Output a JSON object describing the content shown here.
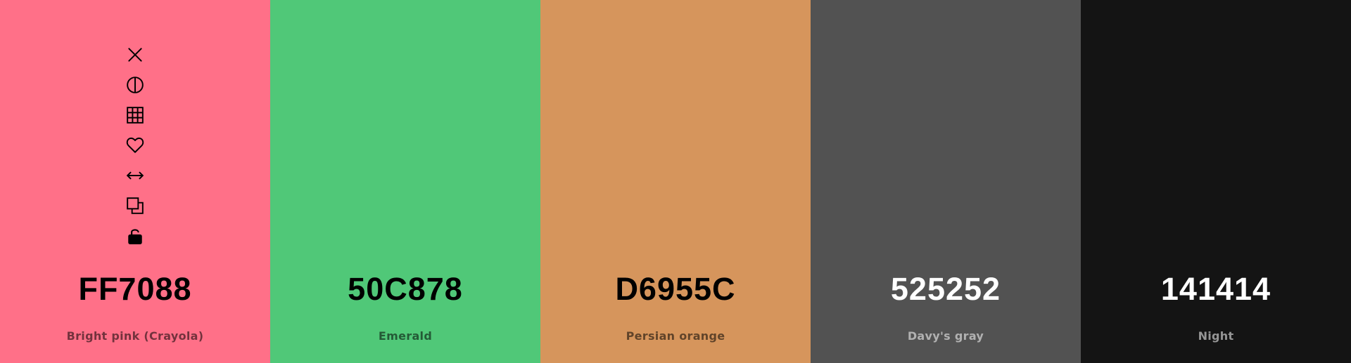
{
  "swatches": [
    {
      "hex": "FF7088",
      "name": "Bright pink (Crayola)",
      "color": "#FF7088"
    },
    {
      "hex": "50C878",
      "name": "Emerald",
      "color": "#50C878"
    },
    {
      "hex": "D6955C",
      "name": "Persian orange",
      "color": "#D6955C"
    },
    {
      "hex": "525252",
      "name": "Davy's gray",
      "color": "#525252"
    },
    {
      "hex": "141414",
      "name": "Night",
      "color": "#141414"
    }
  ],
  "toolbar_icons": [
    "close-icon",
    "contrast-icon",
    "shades-grid-icon",
    "heart-icon",
    "drag-arrows-icon",
    "copy-icon",
    "unlock-icon"
  ]
}
